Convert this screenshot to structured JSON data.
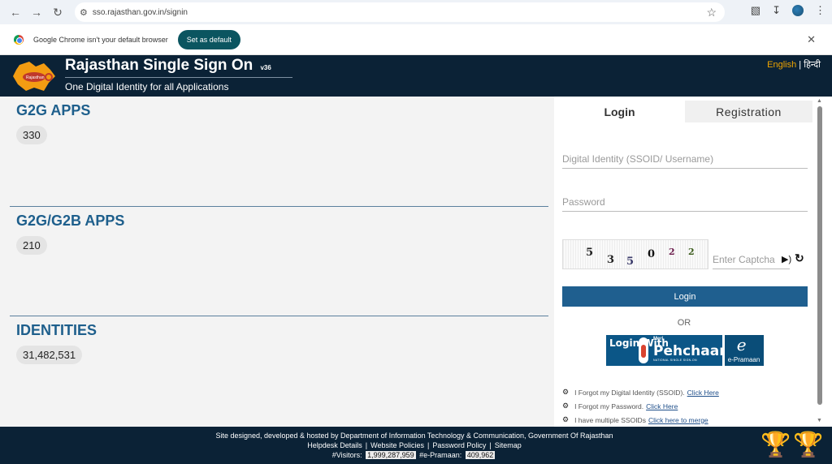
{
  "browser": {
    "url": "sso.rajasthan.gov.in/signin",
    "infobar_message": "Google Chrome isn't your default browser",
    "set_default_label": "Set as default"
  },
  "header": {
    "title": "Rajasthan Single Sign On",
    "version": "v36",
    "subtitle": "One Digital Identity for all Applications",
    "lang_english": "English",
    "lang_sep": "|",
    "lang_hindi": "हिन्दी",
    "logo_text": "Rajasthan"
  },
  "stats": [
    {
      "label": "G2G APPS",
      "value": "330"
    },
    {
      "label": "G2G/G2B APPS",
      "value": "210"
    },
    {
      "label": "IDENTITIES",
      "value": "31,482,531"
    }
  ],
  "login_panel": {
    "tab_login": "Login",
    "tab_registration": "Registration",
    "ssoid_placeholder": "Digital Identity (SSOID/ Username)",
    "password_placeholder": "Password",
    "captcha_chars": [
      "5",
      "3",
      "5",
      "0",
      "2",
      "2"
    ],
    "captcha_placeholder": "Enter Captcha",
    "login_button": "Login",
    "or_text": "OR",
    "pehchaan": {
      "login_with": "Login With",
      "meri": "Meri",
      "name": "Pehchaan",
      "sub": "NATIONAL SINGLE SIGN-ON",
      "epramaan_e": "e",
      "epramaan": "e-Pramaan"
    },
    "help_links": [
      {
        "text": "I Forgot my Digital Identity (SSOID).",
        "link": "Click Here"
      },
      {
        "text": "I Forgot my Password.",
        "link": "Click Here"
      },
      {
        "text": "I have multiple SSOIDs",
        "link": "Click here to merge"
      }
    ]
  },
  "footer": {
    "credit": "Site designed, developed & hosted by Department of Information Technology & Communication, Government Of Rajasthan",
    "links": [
      "Helpdesk Details",
      "Website Policies",
      "Password Policy",
      "Sitemap"
    ],
    "visitors_label": "#Visitors:",
    "visitors_value": "1,999,287,959",
    "epramaan_label": "#e-Pramaan:",
    "epramaan_value": "409,962"
  },
  "icons": {
    "back": "arrow-left-icon",
    "forward": "arrow-right-icon",
    "reload": "reload-icon",
    "bookmark": "star-icon",
    "extensions": "puzzle-icon",
    "downloads": "download-icon",
    "audio": "speaker-icon",
    "refresh": "refresh-icon",
    "help": "gear-icon",
    "trophy": "trophy-icon"
  },
  "colors": {
    "header_bg": "#0b2236",
    "accent_blue": "#1f5f8f",
    "lang_active": "#f0a500",
    "default_btn": "#0b5560"
  }
}
